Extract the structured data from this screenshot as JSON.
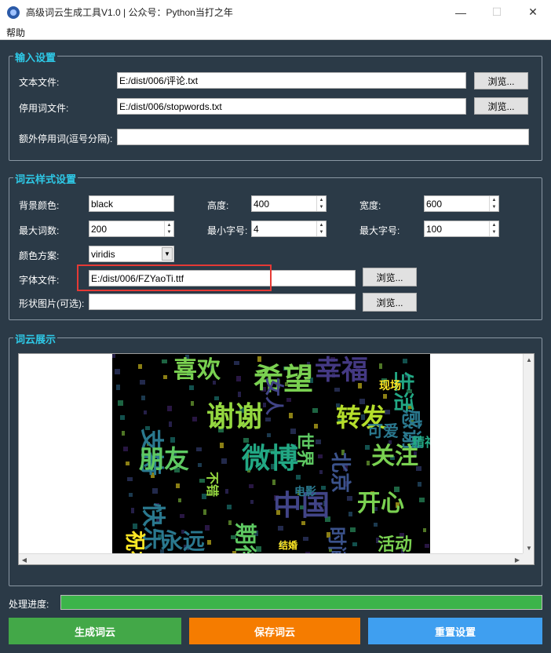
{
  "window": {
    "title": "高级词云生成工具V1.0 | 公众号：Python当打之年",
    "minimize": "—",
    "maximize": "☐",
    "close": "✕"
  },
  "menu": {
    "help": "帮助"
  },
  "input_settings": {
    "title": "输入设置",
    "text_file_label": "文本文件:",
    "text_file_value": "E:/dist/006/评论.txt",
    "stopwords_label": "停用词文件:",
    "stopwords_value": "E:/dist/006/stopwords.txt",
    "extra_stopwords_label": "额外停用词(逗号分隔):",
    "extra_stopwords_value": "",
    "browse": "浏览..."
  },
  "style_settings": {
    "title": "词云样式设置",
    "bg_color_label": "背景颜色:",
    "bg_color_value": "black",
    "height_label": "高度:",
    "height_value": "400",
    "width_label": "宽度:",
    "width_value": "600",
    "max_words_label": "最大词数:",
    "max_words_value": "200",
    "min_font_label": "最小字号:",
    "min_font_value": "4",
    "max_font_label": "最大字号:",
    "max_font_value": "100",
    "colormap_label": "颜色方案:",
    "colormap_value": "viridis",
    "font_file_label": "字体文件:",
    "font_file_value": "E:/dist/006/FZYaoTi.ttf",
    "shape_label": "形状图片(可选):",
    "shape_value": "",
    "browse": "浏览..."
  },
  "display": {
    "title": "词云展示",
    "words": [
      {
        "t": "喜欢",
        "c": "#7ad151"
      },
      {
        "t": "支持",
        "c": "#2a788e"
      },
      {
        "t": "谢谢",
        "c": "#95d840"
      },
      {
        "t": "希望",
        "c": "#7ad151"
      },
      {
        "t": "幸福",
        "c": "#443983"
      },
      {
        "t": "女人",
        "c": "#414487"
      },
      {
        "t": "生活",
        "c": "#22a884"
      },
      {
        "t": "转发",
        "c": "#b5de2b"
      },
      {
        "t": "感谢",
        "c": "#2a788e"
      },
      {
        "t": "世界",
        "c": "#5ec962"
      },
      {
        "t": "朋友",
        "c": "#5ec962"
      },
      {
        "t": "微博",
        "c": "#22a884"
      },
      {
        "t": "北京",
        "c": "#3b528b"
      },
      {
        "t": "关注",
        "c": "#7ad151"
      },
      {
        "t": "快乐",
        "c": "#2a788e"
      },
      {
        "t": "中国",
        "c": "#414487"
      },
      {
        "t": "开心",
        "c": "#7ad151"
      },
      {
        "t": "祝福",
        "c": "#fde725"
      },
      {
        "t": "期待",
        "c": "#5ec962"
      },
      {
        "t": "时间",
        "c": "#3b528b"
      },
      {
        "t": "永远",
        "c": "#2a788e"
      },
      {
        "t": "活动",
        "c": "#7ad151"
      },
      {
        "t": "不错",
        "c": "#95d840"
      },
      {
        "t": "可爱",
        "c": "#2a788e"
      },
      {
        "t": "现场",
        "c": "#fde725"
      },
      {
        "t": "精神",
        "c": "#22a884"
      },
      {
        "t": "电影",
        "c": "#2a788e"
      },
      {
        "t": "结婚",
        "c": "#fde725"
      }
    ]
  },
  "progress": {
    "label": "处理进度:",
    "value": 1.0
  },
  "actions": {
    "generate": "生成词云",
    "save": "保存词云",
    "reset": "重置设置"
  },
  "colors": {
    "background": "#2b3a47",
    "group_title": "#2ec8e6",
    "generate_btn": "#43a848",
    "save_btn": "#f57c00",
    "reset_btn": "#3f9ff0",
    "highlight": "#e53935"
  }
}
